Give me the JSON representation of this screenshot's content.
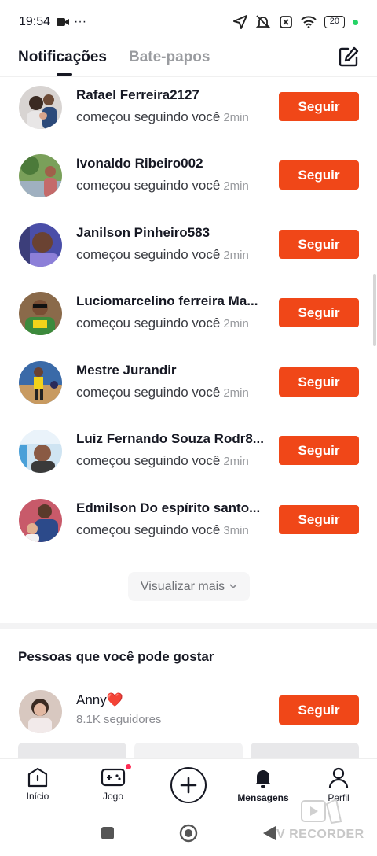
{
  "status_bar": {
    "time": "19:54",
    "more": "···",
    "battery": "20"
  },
  "header": {
    "tabs": [
      {
        "label": "Notificações",
        "active": true
      },
      {
        "label": "Bate-papos",
        "active": false
      }
    ]
  },
  "notifications": [
    {
      "name": "Rafael Ferreira2127",
      "action": "começou seguindo você",
      "time": "2min",
      "button": "Seguir"
    },
    {
      "name": "Ivonaldo Ribeiro002",
      "action": "começou seguindo você",
      "time": "2min",
      "button": "Seguir"
    },
    {
      "name": "Janilson Pinheiro583",
      "action": "começou seguindo você",
      "time": "2min",
      "button": "Seguir"
    },
    {
      "name": "Luciomarcelino ferreira Ma...",
      "action": "começou seguindo você",
      "time": "2min",
      "button": "Seguir"
    },
    {
      "name": "Mestre Jurandir",
      "action": "começou seguindo você",
      "time": "2min",
      "button": "Seguir"
    },
    {
      "name": "Luiz Fernando Souza Rodr8...",
      "action": "começou seguindo você",
      "time": "2min",
      "button": "Seguir"
    },
    {
      "name": "Edmilson Do espírito santo...",
      "action": "começou seguindo você",
      "time": "3min",
      "button": "Seguir"
    }
  ],
  "show_more": {
    "label": "Visualizar mais"
  },
  "suggestions": {
    "title": "Pessoas que você pode gostar",
    "items": [
      {
        "name": "Anny❤️",
        "followers": "8.1K seguidores",
        "button": "Seguir"
      }
    ]
  },
  "bottom_nav": {
    "items": [
      {
        "label": "Início",
        "icon": "home-icon"
      },
      {
        "label": "Jogo",
        "icon": "game-controller-icon"
      },
      {
        "label": "",
        "icon": "plus-icon"
      },
      {
        "label": "Mensagens",
        "icon": "bell-icon"
      },
      {
        "label": "Perfil",
        "icon": "profile-icon"
      }
    ]
  },
  "watermark": "V RECORDER",
  "colors": {
    "accent": "#f04718",
    "text": "#161823",
    "muted": "#9a9ca0",
    "badge": "#fe2c55"
  }
}
